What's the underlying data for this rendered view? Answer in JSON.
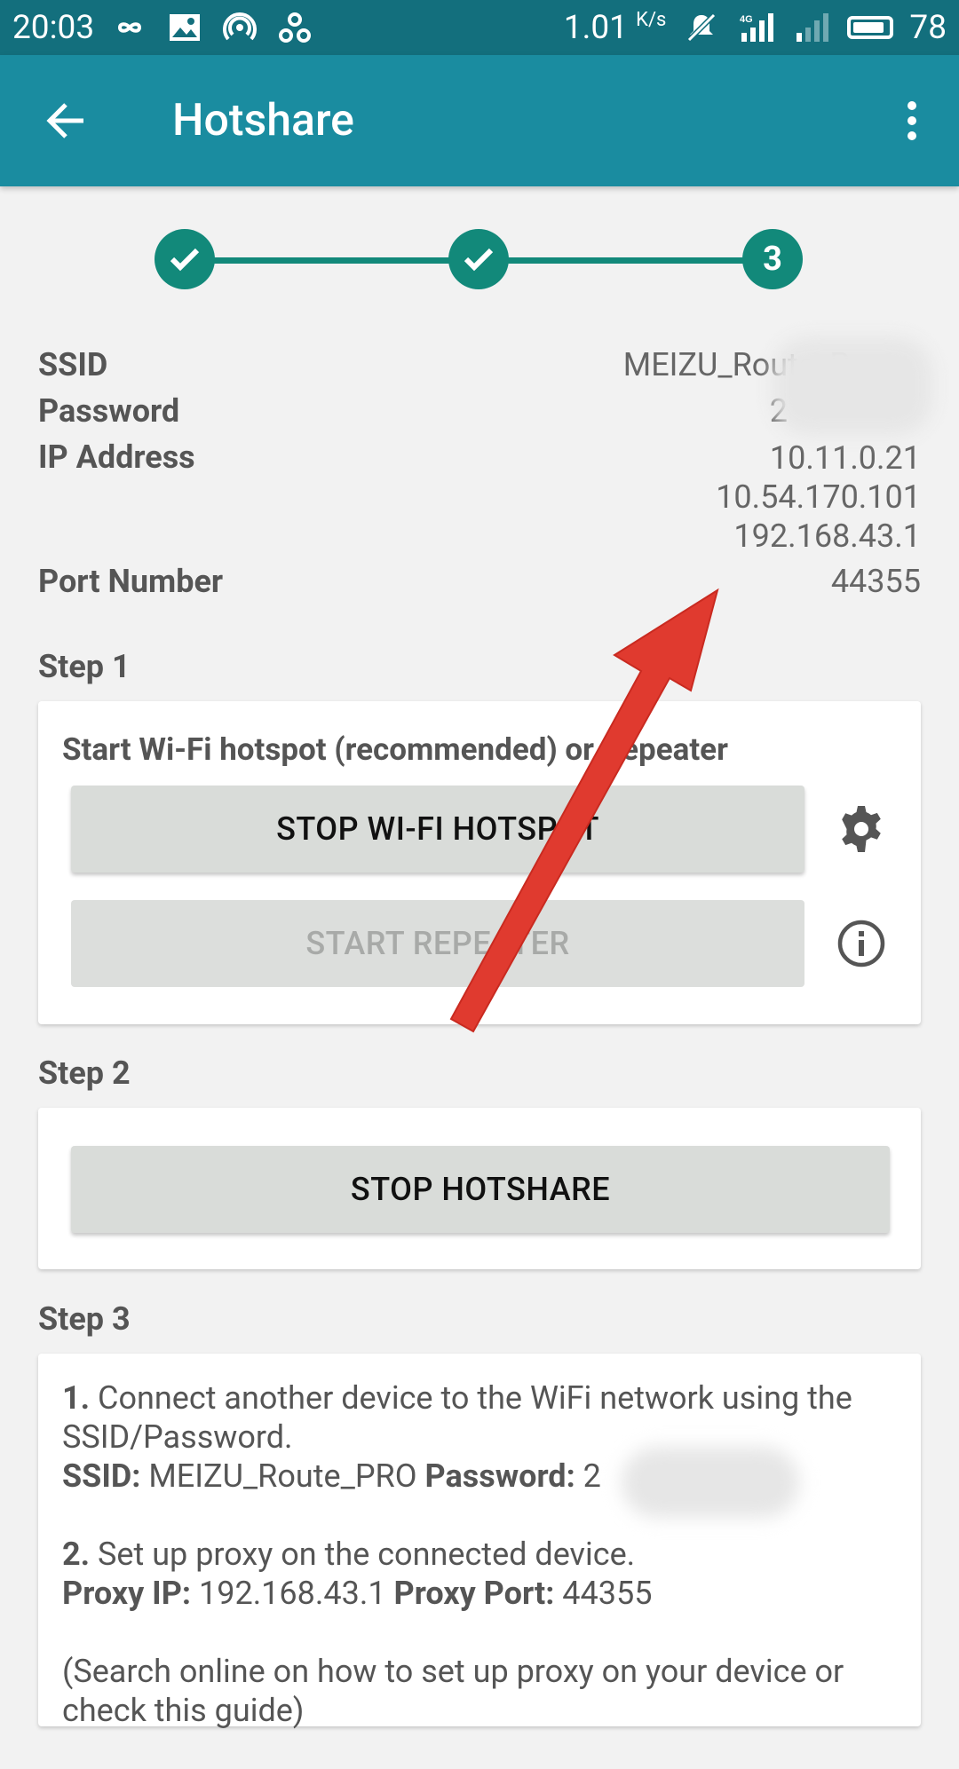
{
  "status_bar": {
    "time": "20:03",
    "speed": "1.01",
    "speed_unit": "K/s",
    "battery": "78",
    "icons": [
      "infinity-icon",
      "image-icon",
      "hotspot-icon",
      "link-icon",
      "mute-icon",
      "signal-4g-icon",
      "signal-icon",
      "battery-icon"
    ]
  },
  "app_bar": {
    "title": "Hotshare"
  },
  "stepper": {
    "steps": [
      "check",
      "check",
      "3"
    ]
  },
  "info": {
    "ssid_label": "SSID",
    "ssid_value": "MEIZU_Route_P",
    "password_label": "Password",
    "password_value": "2",
    "ip_label": "IP Address",
    "ip_values": [
      "10.11.0.21",
      "10.54.170.101",
      "192.168.43.1"
    ],
    "port_label": "Port Number",
    "port_value": "44355"
  },
  "step1": {
    "heading": "Step 1",
    "card_title": "Start Wi-Fi hotspot (recommended) or Repeater",
    "stop_hotspot_button": "STOP WI-FI HOTSPOT",
    "start_repeater_button": "START REPEATER"
  },
  "step2": {
    "heading": "Step 2",
    "stop_hotshare_button": "STOP HOTSHARE"
  },
  "step3": {
    "heading": "Step 3",
    "item1_num": "1.",
    "item1_text": " Connect another device to the WiFi network using the SSID/Password.",
    "ssid_label": "SSID:",
    "ssid_value": " MEIZU_Route_PRO ",
    "password_label": "Password:",
    "password_value": " 2",
    "item2_num": "2.",
    "item2_text": " Set up proxy on the connected device.",
    "proxy_ip_label": "Proxy IP:",
    "proxy_ip_value": " 192.168.43.1 ",
    "proxy_port_label": "Proxy Port:",
    "proxy_port_value": " 44355",
    "note": "(Search online on how to set up proxy on your device or check this guide)"
  },
  "colors": {
    "status_bar": "#136f7d",
    "app_bar": "#1a8ca0",
    "stepper": "#12897a",
    "annotation_arrow": "#e03a2f"
  }
}
